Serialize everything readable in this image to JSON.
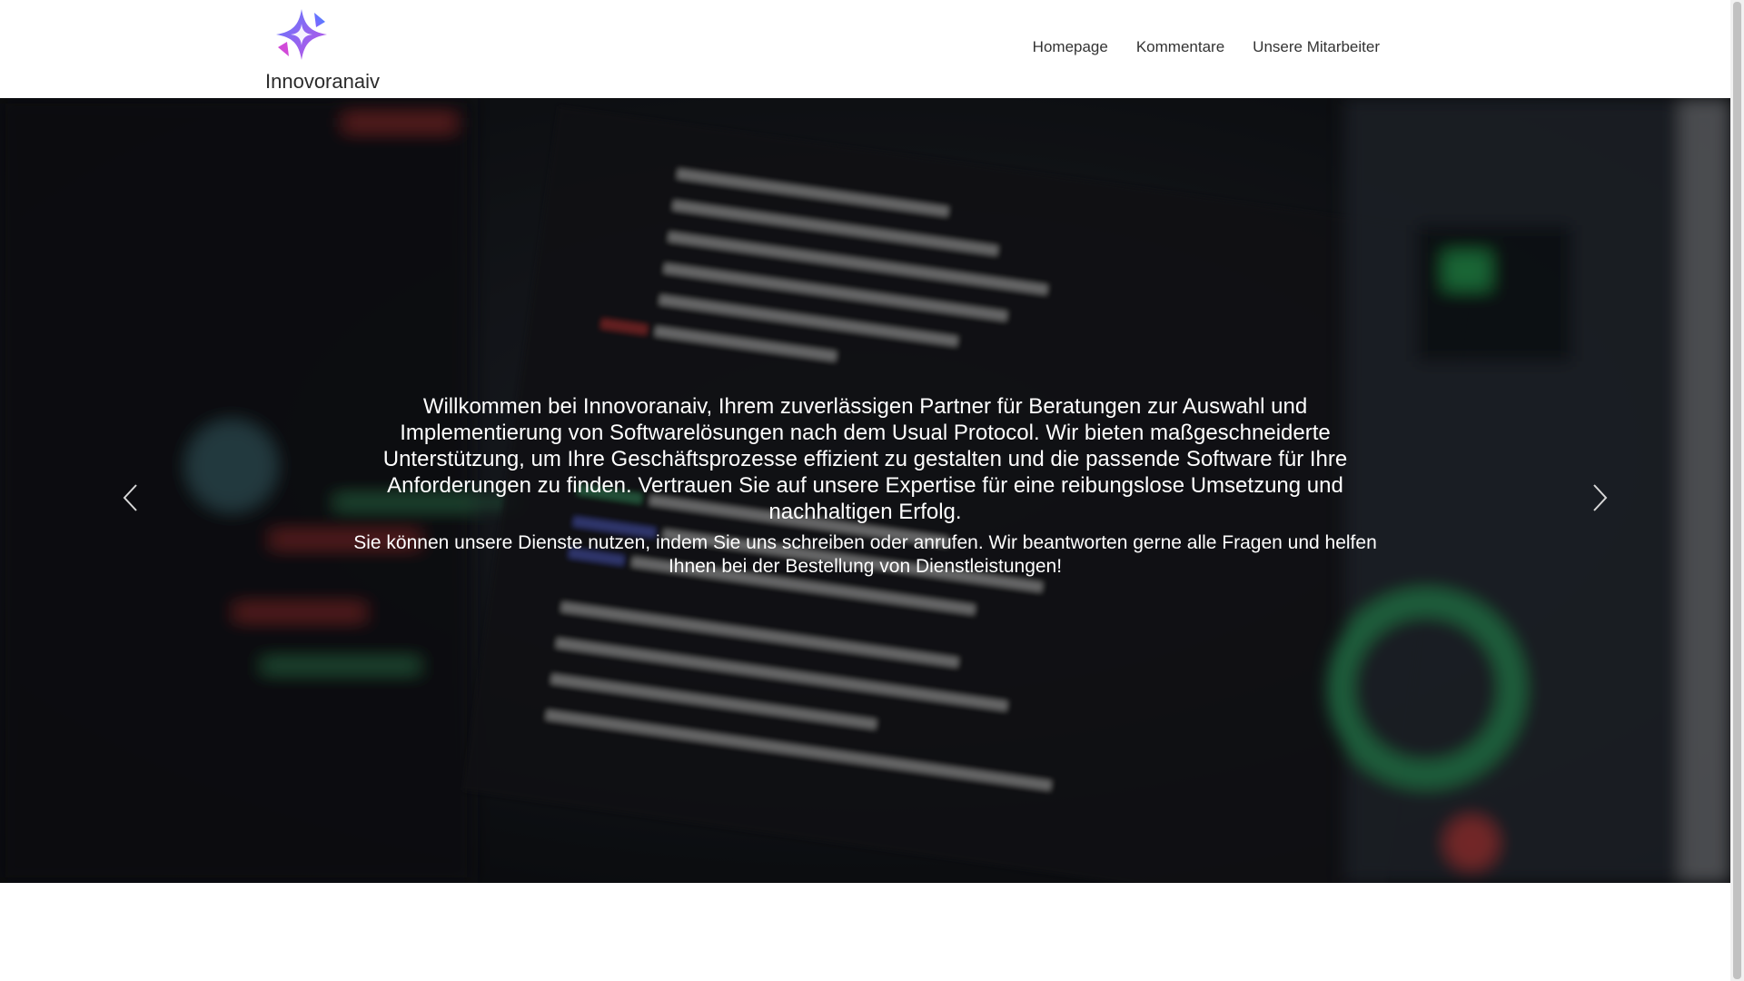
{
  "header": {
    "brand_name": "Innovoranaiv",
    "logo_icon": "four-point-star-logo-icon",
    "nav": [
      {
        "label": "Homepage"
      },
      {
        "label": "Kommentare"
      },
      {
        "label": "Unsere Mitarbeiter"
      }
    ]
  },
  "hero": {
    "background": "blurred-code-editor-photo",
    "title": "Willkommen bei Innovoranaiv, Ihrem zuverlässigen Partner für Beratungen zur Auswahl und Implementierung von Softwarelösungen nach dem Usual Protocol. Wir bieten maßgeschneiderte Unterstützung, um Ihre Geschäftsprozesse effizient zu gestalten und die passende Software für Ihre Anforderungen zu finden. Vertrauen Sie auf unsere Expertise für eine reibungslose Umsetzung und nachhaltigen Erfolg.",
    "subtitle": "Sie können unsere Dienste nutzen, indem Sie uns schreiben oder anrufen. Wir beantworten gerne alle Fragen und helfen Ihnen bei der Bestellung von Dienstleistungen!",
    "prev_icon": "chevron-left-icon",
    "next_icon": "chevron-right-icon"
  },
  "colors": {
    "logo_gradient_start": "#4f6bff",
    "logo_gradient_end": "#d04fe0",
    "nav_text": "#333333",
    "hero_text": "#ffffff"
  }
}
